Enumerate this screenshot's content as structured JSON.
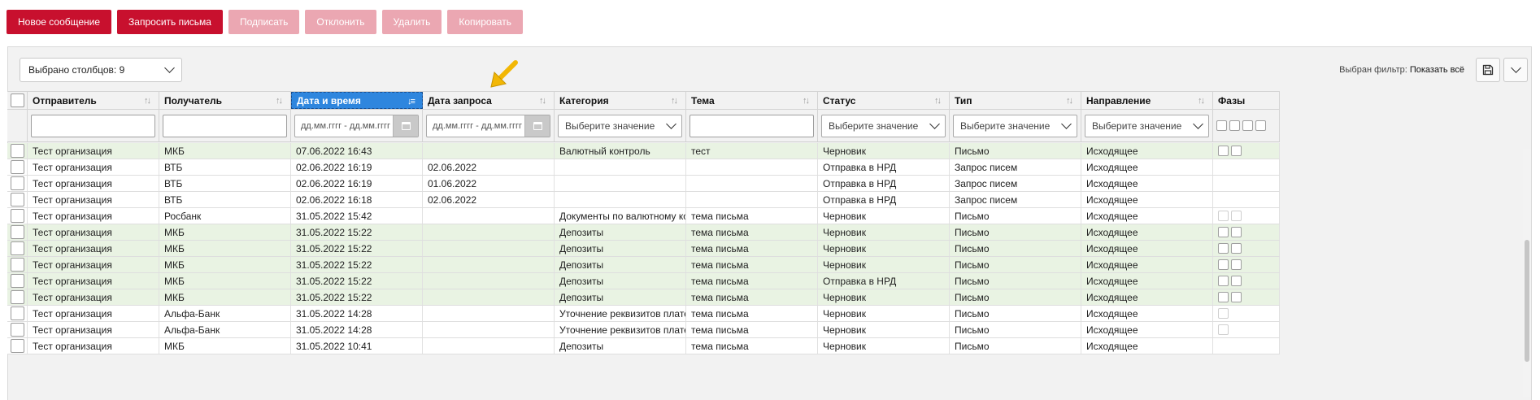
{
  "toolbar": {
    "new_message": "Новое сообщение",
    "request_letters": "Запросить письма",
    "sign": "Подписать",
    "reject": "Отклонить",
    "delete": "Удалить",
    "copy": "Копировать"
  },
  "column_selector": {
    "label": "Выбрано столбцов: 9"
  },
  "filter_info": {
    "label": "Выбран фильтр:",
    "value": "Показать всё"
  },
  "icons": {
    "save": "save-icon",
    "expand": "chevron-down-icon",
    "sort": "sort-icon",
    "calendar": "calendar-icon"
  },
  "colors": {
    "primary": "#c8102e",
    "disabled": "#eba7b2",
    "active_header": "#2e86de",
    "highlight_row": "#e9f3e3",
    "arrow": "#f2b705"
  },
  "columns": [
    "Отправитель",
    "Получатель",
    "Дата и время",
    "Дата запроса",
    "Категория",
    "Тема",
    "Статус",
    "Тип",
    "Направление",
    "Фазы"
  ],
  "filters": {
    "date_placeholder": "дд.мм.гггг - дд.мм.гггг",
    "select_placeholder": "Выберите значение"
  },
  "rows": [
    {
      "sender": "Тест организация",
      "recipient": "МКБ",
      "datetime": "07.06.2022 16:43",
      "request_date": "",
      "category": "Валютный контроль",
      "subject": "тест",
      "status": "Черновик",
      "type": "Письмо",
      "direction": "Исходящее"
    },
    {
      "sender": "Тест организация",
      "recipient": "ВТБ",
      "datetime": "02.06.2022 16:19",
      "request_date": "02.06.2022",
      "category": "",
      "subject": "",
      "status": "Отправка в НРД",
      "type": "Запрос писем",
      "direction": "Исходящее"
    },
    {
      "sender": "Тест организация",
      "recipient": "ВТБ",
      "datetime": "02.06.2022 16:19",
      "request_date": "01.06.2022",
      "category": "",
      "subject": "",
      "status": "Отправка в НРД",
      "type": "Запрос писем",
      "direction": "Исходящее"
    },
    {
      "sender": "Тест организация",
      "recipient": "ВТБ",
      "datetime": "02.06.2022 16:18",
      "request_date": "02.06.2022",
      "category": "",
      "subject": "",
      "status": "Отправка в НРД",
      "type": "Запрос писем",
      "direction": "Исходящее"
    },
    {
      "sender": "Тест организация",
      "recipient": "Росбанк",
      "datetime": "31.05.2022 15:42",
      "request_date": "",
      "category": "Документы по валютному конт...",
      "subject": "тема письма",
      "status": "Черновик",
      "type": "Письмо",
      "direction": "Исходящее"
    },
    {
      "sender": "Тест организация",
      "recipient": "МКБ",
      "datetime": "31.05.2022 15:22",
      "request_date": "",
      "category": "Депозиты",
      "subject": "тема письма",
      "status": "Черновик",
      "type": "Письмо",
      "direction": "Исходящее"
    },
    {
      "sender": "Тест организация",
      "recipient": "МКБ",
      "datetime": "31.05.2022 15:22",
      "request_date": "",
      "category": "Депозиты",
      "subject": "тема письма",
      "status": "Черновик",
      "type": "Письмо",
      "direction": "Исходящее"
    },
    {
      "sender": "Тест организация",
      "recipient": "МКБ",
      "datetime": "31.05.2022 15:22",
      "request_date": "",
      "category": "Депозиты",
      "subject": "тема письма",
      "status": "Черновик",
      "type": "Письмо",
      "direction": "Исходящее"
    },
    {
      "sender": "Тест организация",
      "recipient": "МКБ",
      "datetime": "31.05.2022 15:22",
      "request_date": "",
      "category": "Депозиты",
      "subject": "тема письма",
      "status": "Отправка в НРД",
      "type": "Письмо",
      "direction": "Исходящее"
    },
    {
      "sender": "Тест организация",
      "recipient": "МКБ",
      "datetime": "31.05.2022 15:22",
      "request_date": "",
      "category": "Депозиты",
      "subject": "тема письма",
      "status": "Черновик",
      "type": "Письмо",
      "direction": "Исходящее"
    },
    {
      "sender": "Тест организация",
      "recipient": "Альфа-Банк",
      "datetime": "31.05.2022 14:28",
      "request_date": "",
      "category": "Уточнение реквизитов платежа",
      "subject": "тема письма",
      "status": "Черновик",
      "type": "Письмо",
      "direction": "Исходящее"
    },
    {
      "sender": "Тест организация",
      "recipient": "Альфа-Банк",
      "datetime": "31.05.2022 14:28",
      "request_date": "",
      "category": "Уточнение реквизитов платежа",
      "subject": "тема письма",
      "status": "Черновик",
      "type": "Письмо",
      "direction": "Исходящее"
    },
    {
      "sender": "Тест организация",
      "recipient": "МКБ",
      "datetime": "31.05.2022 10:41",
      "request_date": "",
      "category": "Депозиты",
      "subject": "тема письма",
      "status": "Черновик",
      "type": "Письмо",
      "direction": "Исходящее"
    }
  ]
}
